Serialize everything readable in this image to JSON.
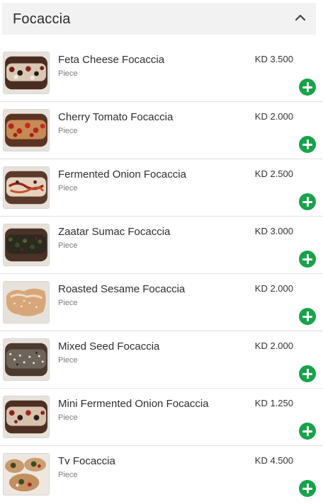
{
  "section": {
    "title": "Focaccia",
    "collapse_icon": "chevron-up-icon"
  },
  "items": [
    {
      "name": "Feta Cheese Focaccia",
      "unit": "Piece",
      "price": "KD 3.500",
      "thumb_icon": "focaccia-image"
    },
    {
      "name": "Cherry Tomato Focaccia",
      "unit": "Piece",
      "price": "KD 2.000",
      "thumb_icon": "focaccia-image"
    },
    {
      "name": "Fermented Onion Focaccia",
      "unit": "Piece",
      "price": "KD 2.500",
      "thumb_icon": "focaccia-image"
    },
    {
      "name": "Zaatar Sumac Focaccia",
      "unit": "Piece",
      "price": "KD 3.000",
      "thumb_icon": "focaccia-image"
    },
    {
      "name": "Roasted Sesame Focaccia",
      "unit": "Piece",
      "price": "KD 2.000",
      "thumb_icon": "focaccia-image"
    },
    {
      "name": "Mixed Seed Focaccia",
      "unit": "Piece",
      "price": "KD 2.000",
      "thumb_icon": "focaccia-image"
    },
    {
      "name": "Mini Fermented Onion Focaccia",
      "unit": "Piece",
      "price": "KD 1.250",
      "thumb_icon": "focaccia-image"
    },
    {
      "name": "Tv Focaccia",
      "unit": "Piece",
      "price": "KD 4.500",
      "thumb_icon": "focaccia-image"
    }
  ],
  "colors": {
    "add_button": "#16a34a",
    "header_background": "#f2f2f2"
  }
}
